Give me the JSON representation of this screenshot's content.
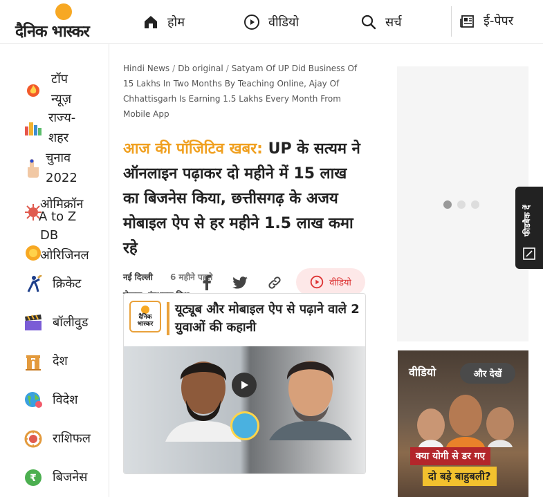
{
  "header": {
    "logo_text": "दैनिक भास्कर",
    "nav": [
      {
        "label": "होम",
        "icon": "home-icon"
      },
      {
        "label": "वीडियो",
        "icon": "play-circle-icon"
      },
      {
        "label": "सर्च",
        "icon": "search-icon"
      },
      {
        "label": "ई-पेपर",
        "icon": "newspaper-icon"
      }
    ]
  },
  "sidebar": {
    "items": [
      {
        "label": "टॉप\nन्यूज़",
        "icon": "fire-icon"
      },
      {
        "label": "राज्य-\nशहर",
        "icon": "city-icon"
      },
      {
        "label": "चुनाव\n2022",
        "icon": "vote-finger-icon"
      },
      {
        "label": "ओमिक्रॉन",
        "icon": "virus-icon"
      },
      {
        "label": "A to Z",
        "icon": ""
      },
      {
        "label": "DB\nओरिजिनल",
        "icon": "db-original-icon"
      },
      {
        "label": "क्रिकेट",
        "icon": "cricket-icon"
      },
      {
        "label": "बॉलीवुड",
        "icon": "clapperboard-icon"
      },
      {
        "label": "देश",
        "icon": "india-gate-icon"
      },
      {
        "label": "विदेश",
        "icon": "globe-icon"
      },
      {
        "label": "राशिफल",
        "icon": "zodiac-icon"
      },
      {
        "label": "बिजनेस",
        "icon": "rupee-icon"
      }
    ]
  },
  "breadcrumb": {
    "items": [
      "Hindi News",
      "Db original",
      "Satyam Of UP Did Business Of 15 Lakhs In Two Months By Teaching Online, Ajay Of Chhattisgarh Is Earning 1.5 Lakhs Every Month From Mobile App"
    ]
  },
  "article": {
    "kicker": "आज की पॉजिटिव खबर:",
    "headline": "UP के सत्यम ने ऑनलाइन पढ़ाकर दो महीने में 15 लाख का बिजनेस किया, छत्तीसगढ़ के अजय मोबाइल ऐप से हर महीने 1.5 लाख कमा रहे",
    "place": "नई दिल्ली",
    "time": "6 महीने पहले",
    "author": "लेखक: इंद्रभूषण मिश्र",
    "share_icons": [
      "facebook-icon",
      "twitter-icon",
      "link-icon"
    ],
    "video_button_label": "वीडियो"
  },
  "hero": {
    "logo_text": "दैनिक भास्कर",
    "banner_text": "यूट्यूब और मोबाइल ऐप से पढ़ाने वाले 2 युवाओं की कहानी"
  },
  "right": {
    "feedback_label": "फीडबैक दें",
    "video_card": {
      "title": "वीडियो",
      "more_label": "और देखें",
      "caption_line1": "क्या योगी से डर गए",
      "caption_line2": "दो बड़े बाहुबली?"
    }
  },
  "colors": {
    "accent_orange": "#f0a020",
    "logo_sun": "#f7a823",
    "video_red": "#d33",
    "video_pill_bg": "#fde8e8"
  }
}
